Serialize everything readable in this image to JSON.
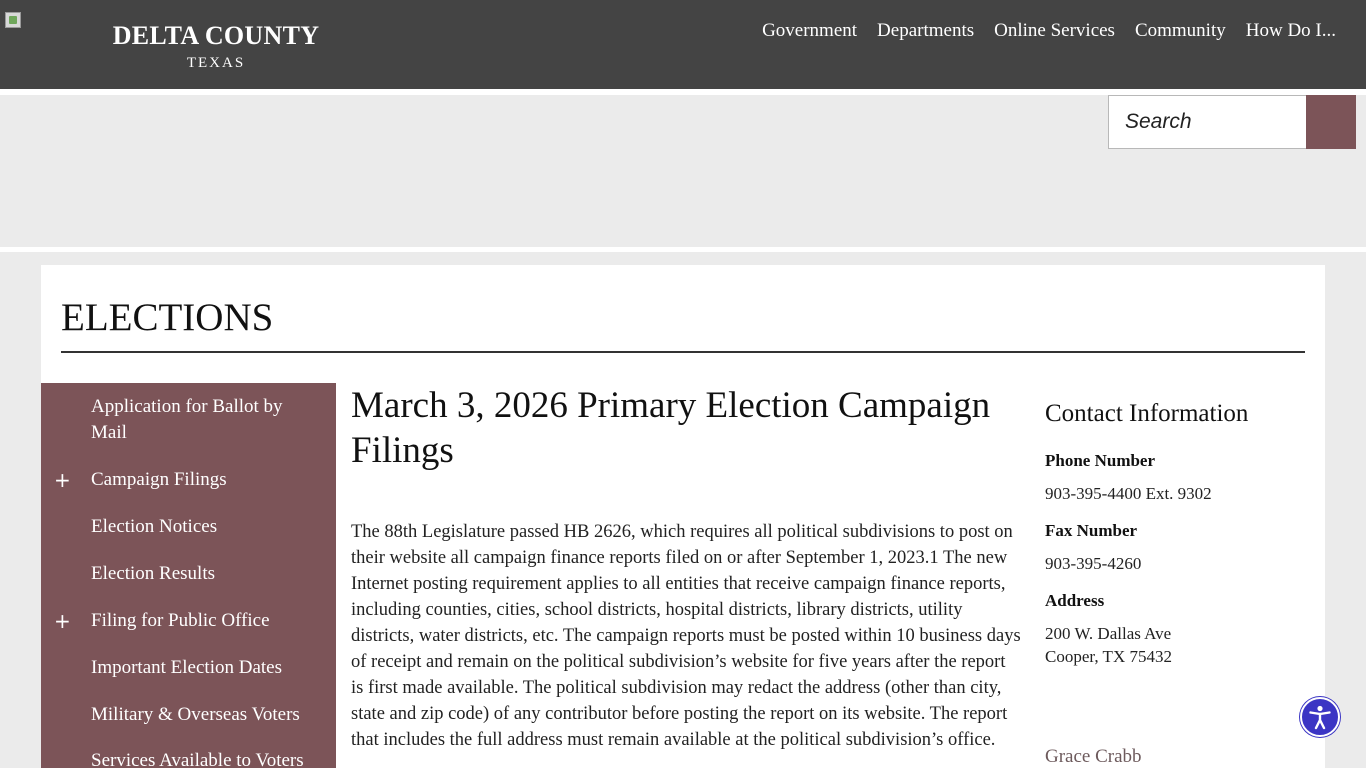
{
  "header": {
    "logo_alt": "logo-image",
    "brand_title": "DELTA COUNTY",
    "brand_subtitle": "TEXAS",
    "nav": [
      "Government",
      "Departments",
      "Online Services",
      "Community",
      "How Do I..."
    ]
  },
  "search": {
    "placeholder": "Search",
    "button_icon": "search-icon"
  },
  "page": {
    "title": "ELECTIONS"
  },
  "sidebar": {
    "items": [
      {
        "label": "Application for Ballot by Mail",
        "expandable": false
      },
      {
        "label": "Campaign Filings",
        "expandable": true
      },
      {
        "label": "Election Notices",
        "expandable": false
      },
      {
        "label": "Election Results",
        "expandable": false
      },
      {
        "label": "Filing for Public Office",
        "expandable": true
      },
      {
        "label": "Important Election Dates",
        "expandable": false
      },
      {
        "label": "Military & Overseas Voters",
        "expandable": false
      },
      {
        "label": "Services Available to Voters",
        "expandable": false
      }
    ],
    "expand_symbol": "+"
  },
  "article": {
    "title": "March 3, 2026 Primary Election Campaign Filings",
    "body": "The 88th Legislature passed HB 2626, which requires all political subdivisions to post on their website all campaign finance reports filed on or after September 1, 2023.1 The new Internet posting requirement applies to all entities that receive campaign finance reports, including counties, cities, school districts, hospital districts, library districts, utility districts, water districts, etc. The campaign reports must be posted within 10 business days of receipt and remain on the political subdivision’s website for five years after the report is first made available. The political subdivision may redact the address (other than city, state and zip code) of any contributor before posting the report on its website. The report that includes the full address must remain available at the political subdivision’s office."
  },
  "contact": {
    "heading": "Contact Information",
    "phone_label": "Phone Number",
    "phone": "903-395-4400 Ext. 9302",
    "fax_label": "Fax Number",
    "fax": "903-395-4260",
    "address_label": "Address",
    "address_line1": "200 W. Dallas Ave",
    "address_line2": "Cooper, TX 75432",
    "person": "Grace Crabb"
  },
  "widgets": {
    "accessibility_icon": "accessibility-icon"
  },
  "colors": {
    "header_bg": "#444444",
    "accent": "#7c5458",
    "accessibility": "#3b35c4"
  }
}
